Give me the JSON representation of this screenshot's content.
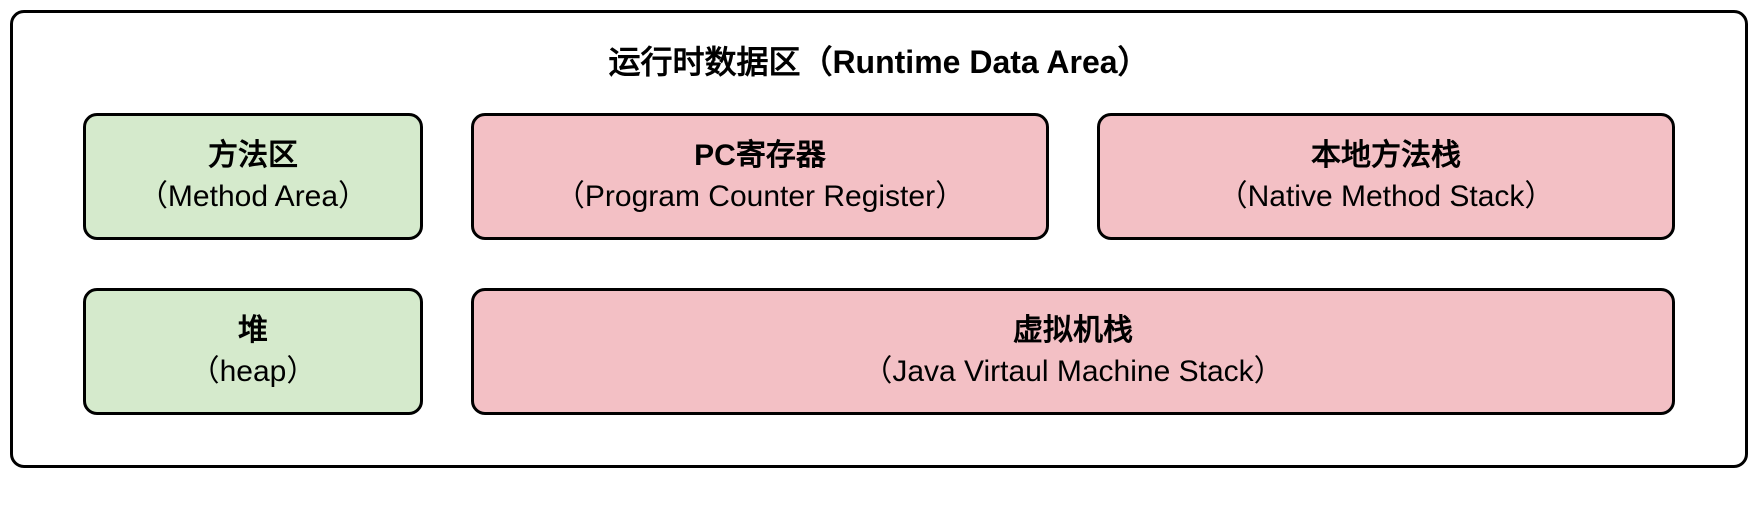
{
  "title": "运行时数据区（Runtime Data Area）",
  "boxes": {
    "method_area": {
      "cn": "方法区",
      "en": "（Method Area）"
    },
    "pc_register": {
      "cn": "PC寄存器",
      "en": "（Program Counter Register）"
    },
    "native_stack": {
      "cn": "本地方法栈",
      "en": "（Native Method Stack）"
    },
    "heap": {
      "cn": "堆",
      "en": "（heap）"
    },
    "vm_stack": {
      "cn": "虚拟机栈",
      "en": "（Java Virtaul Machine Stack）"
    }
  },
  "colors": {
    "green": "#d5eacc",
    "pink": "#f3c0c5",
    "border": "#000000"
  }
}
